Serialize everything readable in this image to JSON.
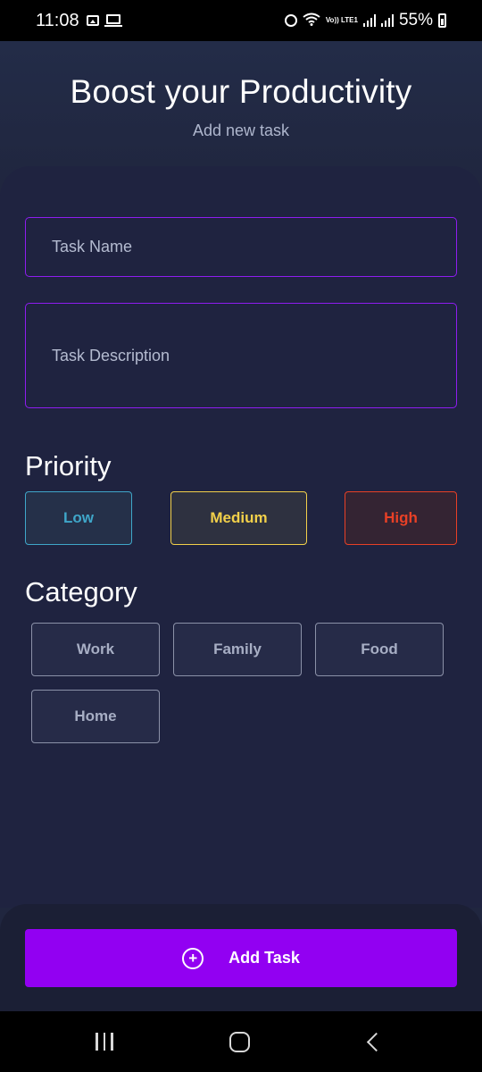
{
  "status_bar": {
    "time": "11:08",
    "battery_percent": "55%",
    "network_label": "Vo)) LTE1",
    "icons": [
      "image-icon",
      "laptop-icon",
      "alarm-icon",
      "wifi-icon",
      "signal-icon",
      "battery-icon"
    ]
  },
  "header": {
    "title": "Boost your Productivity",
    "subtitle": "Add new task"
  },
  "form": {
    "task_name_placeholder": "Task Name",
    "task_description_placeholder": "Task Description"
  },
  "priority": {
    "label": "Priority",
    "options": [
      {
        "label": "Low",
        "color": "#3fa6c9"
      },
      {
        "label": "Medium",
        "color": "#f2d04a"
      },
      {
        "label": "High",
        "color": "#e84026"
      }
    ]
  },
  "category": {
    "label": "Category",
    "options": [
      {
        "label": "Work"
      },
      {
        "label": "Family"
      },
      {
        "label": "Food"
      },
      {
        "label": "Home"
      }
    ]
  },
  "actions": {
    "add_task_label": "Add Task",
    "accent_color": "#9200f2"
  },
  "nav_bar": {
    "icons": [
      "recents-icon",
      "home-icon",
      "back-icon"
    ]
  }
}
